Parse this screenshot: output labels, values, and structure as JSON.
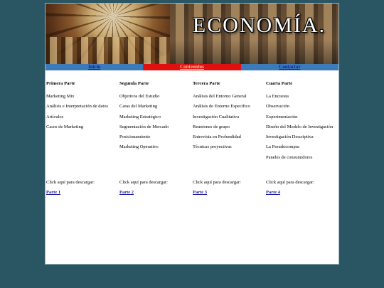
{
  "banner": {
    "title": "ECONOMÍA."
  },
  "nav": [
    {
      "label": "Inicio"
    },
    {
      "label": "Contenidos"
    },
    {
      "label": "Contactar"
    }
  ],
  "columns": [
    {
      "heading": "Primera Parte",
      "items": [
        "Marketing Mix",
        "Análisis e Interpretación de datos",
        "Artículos",
        "Casos de Marketing"
      ],
      "download_text": "Click aquí para descargar:",
      "download_link": "Parte 1"
    },
    {
      "heading": "Segunda Parte",
      "items": [
        "Objetivos del Estudio",
        "Caras del Marketing",
        "Marketing Estratégico",
        "Segmentación de Mercado",
        "Posicionamiento",
        "Marketing Operativo"
      ],
      "download_text": "Click aquí para descargar:",
      "download_link": "Parte 2"
    },
    {
      "heading": "Tercera Parte",
      "items": [
        "Análisis del Entorno General",
        "Análisis de Entorno Específico",
        "Investigación Cualitativa",
        "Reuniones de grupo",
        "Entrevista en Profundidad",
        "Técnicas proyectivas"
      ],
      "download_text": "Click aquí para descargar:",
      "download_link": "Parte 3"
    },
    {
      "heading": "Cuarta Parte",
      "items": [
        "La Encuesta",
        "Observación",
        "Experimentación",
        "Diseño del Modelo de Investigación",
        "Investigación Descriptiva",
        "La Pseudocompra",
        "Paneles de consumidores"
      ],
      "download_text": "Click aquí para descargar:",
      "download_link": "Parte 4"
    }
  ]
}
